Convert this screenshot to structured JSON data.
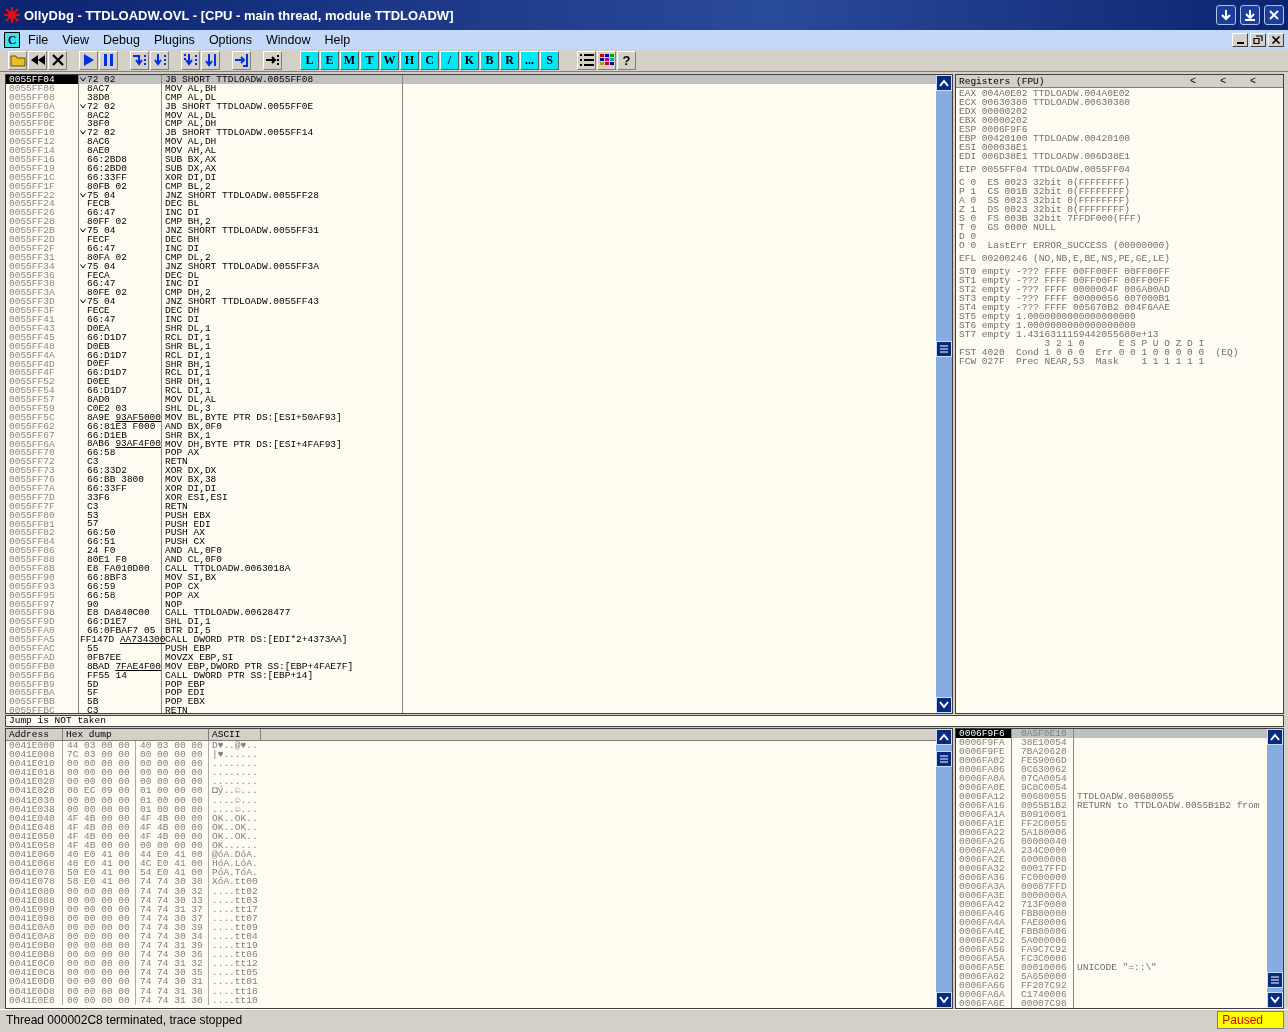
{
  "window": {
    "title": "OllyDbg - TTDLOADW.OVL - [CPU - main thread, module TTDLOADW]"
  },
  "menu": {
    "icon_letter": "C",
    "items": [
      "File",
      "View",
      "Debug",
      "Plugins",
      "Options",
      "Window",
      "Help"
    ]
  },
  "toolbar": {
    "window_buttons": [
      "L",
      "E",
      "M",
      "T",
      "W",
      "H",
      "C",
      "/",
      "K",
      "B",
      "R",
      "...",
      "S"
    ],
    "help": "?"
  },
  "disasm": {
    "rows": [
      {
        "address": "0055FF04",
        "hex": "72 02",
        "command": "JB SHORT TTDLOADW.0055FF08",
        "jump": true,
        "selected": true
      },
      {
        "address": "0055FF06",
        "hex": "8AC7",
        "command": "MOV AL,BH",
        "jump": false,
        "selected": false
      },
      {
        "address": "0055FF08",
        "hex": "38D0",
        "command": "CMP AL,DL",
        "jump": false,
        "selected": false
      },
      {
        "address": "0055FF0A",
        "hex": "72 02",
        "command": "JB SHORT TTDLOADW.0055FF0E",
        "jump": true,
        "selected": false
      },
      {
        "address": "0055FF0C",
        "hex": "8AC2",
        "command": "MOV AL,DL",
        "jump": false,
        "selected": false
      },
      {
        "address": "0055FF0E",
        "hex": "38F0",
        "command": "CMP AL,DH",
        "jump": false,
        "selected": false
      },
      {
        "address": "0055FF10",
        "hex": "72 02",
        "command": "JB SHORT TTDLOADW.0055FF14",
        "jump": true,
        "selected": false
      },
      {
        "address": "0055FF12",
        "hex": "8AC6",
        "command": "MOV AL,DH",
        "jump": false,
        "selected": false
      },
      {
        "address": "0055FF14",
        "hex": "8AE0",
        "command": "MOV AH,AL",
        "jump": false,
        "selected": false
      },
      {
        "address": "0055FF16",
        "hex": "66:2BD8",
        "command": "SUB BX,AX",
        "jump": false,
        "selected": false
      },
      {
        "address": "0055FF19",
        "hex": "66:2BD0",
        "command": "SUB DX,AX",
        "jump": false,
        "selected": false
      },
      {
        "address": "0055FF1C",
        "hex": "66:33FF",
        "command": "XOR DI,DI",
        "jump": false,
        "selected": false
      },
      {
        "address": "0055FF1F",
        "hex": "80FB 02",
        "command": "CMP BL,2",
        "jump": false,
        "selected": false
      },
      {
        "address": "0055FF22",
        "hex": "75 04",
        "command": "JNZ SHORT TTDLOADW.0055FF28",
        "jump": true,
        "selected": false
      },
      {
        "address": "0055FF24",
        "hex": "FECB",
        "command": "DEC BL",
        "jump": false,
        "selected": false
      },
      {
        "address": "0055FF26",
        "hex": "66:47",
        "command": "INC DI",
        "jump": false,
        "selected": false
      },
      {
        "address": "0055FF28",
        "hex": "80FF 02",
        "command": "CMP BH,2",
        "jump": false,
        "selected": false
      },
      {
        "address": "0055FF2B",
        "hex": "75 04",
        "command": "JNZ SHORT TTDLOADW.0055FF31",
        "jump": true,
        "selected": false
      },
      {
        "address": "0055FF2D",
        "hex": "FECF",
        "command": "DEC BH",
        "jump": false,
        "selected": false
      },
      {
        "address": "0055FF2F",
        "hex": "66:47",
        "command": "INC DI",
        "jump": false,
        "selected": false
      },
      {
        "address": "0055FF31",
        "hex": "80FA 02",
        "command": "CMP DL,2",
        "jump": false,
        "selected": false
      },
      {
        "address": "0055FF34",
        "hex": "75 04",
        "command": "JNZ SHORT TTDLOADW.0055FF3A",
        "jump": true,
        "selected": false
      },
      {
        "address": "0055FF36",
        "hex": "FECA",
        "command": "DEC DL",
        "jump": false,
        "selected": false
      },
      {
        "address": "0055FF38",
        "hex": "66:47",
        "command": "INC DI",
        "jump": false,
        "selected": false
      },
      {
        "address": "0055FF3A",
        "hex": "80FE 02",
        "command": "CMP DH,2",
        "jump": false,
        "selected": false
      },
      {
        "address": "0055FF3D",
        "hex": "75 04",
        "command": "JNZ SHORT TTDLOADW.0055FF43",
        "jump": true,
        "selected": false
      },
      {
        "address": "0055FF3F",
        "hex": "FECE",
        "command": "DEC DH",
        "jump": false,
        "selected": false
      },
      {
        "address": "0055FF41",
        "hex": "66:47",
        "command": "INC DI",
        "jump": false,
        "selected": false
      },
      {
        "address": "0055FF43",
        "hex": "D0EA",
        "command": "SHR DL,1",
        "jump": false,
        "selected": false
      },
      {
        "address": "0055FF45",
        "hex": "66:D1D7",
        "command": "RCL DI,1",
        "jump": false,
        "selected": false
      },
      {
        "address": "0055FF48",
        "hex": "D0EB",
        "command": "SHR BL,1",
        "jump": false,
        "selected": false
      },
      {
        "address": "0055FF4A",
        "hex": "66:D1D7",
        "command": "RCL DI,1",
        "jump": false,
        "selected": false
      },
      {
        "address": "0055FF4D",
        "hex": "D0EF",
        "command": "SHR BH,1",
        "jump": false,
        "selected": false
      },
      {
        "address": "0055FF4F",
        "hex": "66:D1D7",
        "command": "RCL DI,1",
        "jump": false,
        "selected": false
      },
      {
        "address": "0055FF52",
        "hex": "D0EE",
        "command": "SHR DH,1",
        "jump": false,
        "selected": false
      },
      {
        "address": "0055FF54",
        "hex": "66:D1D7",
        "command": "RCL DI,1",
        "jump": false,
        "selected": false
      },
      {
        "address": "0055FF57",
        "hex": "8AD0",
        "command": "MOV DL,AL",
        "jump": false,
        "selected": false
      },
      {
        "address": "0055FF59",
        "hex": "C0E2 03",
        "command": "SHL DL,3",
        "jump": false,
        "selected": false
      },
      {
        "address": "0055FF5C",
        "hex": "8A9E",
        "fixup": "93AF5000",
        "command": "MOV BL,BYTE PTR DS:[ESI+50AF93]",
        "jump": false,
        "selected": false
      },
      {
        "address": "0055FF62",
        "hex": "66:81E3 F000",
        "command": "AND BX,0F0",
        "jump": false,
        "selected": false
      },
      {
        "address": "0055FF67",
        "hex": "66:D1EB",
        "command": "SHR BX,1",
        "jump": false,
        "selected": false
      },
      {
        "address": "0055FF6A",
        "hex": "8AB6",
        "fixup": "93AF4F00",
        "command": "MOV DH,BYTE PTR DS:[ESI+4FAF93]",
        "jump": false,
        "selected": false
      },
      {
        "address": "0055FF70",
        "hex": "66:58",
        "command": "POP AX",
        "jump": false,
        "selected": false
      },
      {
        "address": "0055FF72",
        "hex": "C3",
        "command": "RETN",
        "jump": false,
        "selected": false
      },
      {
        "address": "0055FF73",
        "hex": "66:33D2",
        "command": "XOR DX,DX",
        "jump": false,
        "selected": false
      },
      {
        "address": "0055FF76",
        "hex": "66:BB 3800",
        "command": "MOV BX,38",
        "jump": false,
        "selected": false
      },
      {
        "address": "0055FF7A",
        "hex": "66:33FF",
        "command": "XOR DI,DI",
        "jump": false,
        "selected": false
      },
      {
        "address": "0055FF7D",
        "hex": "33F6",
        "command": "XOR ESI,ESI",
        "jump": false,
        "selected": false
      },
      {
        "address": "0055FF7F",
        "hex": "C3",
        "command": "RETN",
        "jump": false,
        "selected": false
      },
      {
        "address": "0055FF80",
        "hex": "53",
        "command": "PUSH EBX",
        "jump": false,
        "selected": false
      },
      {
        "address": "0055FF81",
        "hex": "57",
        "command": "PUSH EDI",
        "jump": false,
        "selected": false
      },
      {
        "address": "0055FF82",
        "hex": "66:50",
        "command": "PUSH AX",
        "jump": false,
        "selected": false
      },
      {
        "address": "0055FF84",
        "hex": "66:51",
        "command": "PUSH CX",
        "jump": false,
        "selected": false
      },
      {
        "address": "0055FF86",
        "hex": "24 F0",
        "command": "AND AL,0F0",
        "jump": false,
        "selected": false
      },
      {
        "address": "0055FF88",
        "hex": "80E1 F0",
        "command": "AND CL,0F0",
        "jump": false,
        "selected": false
      },
      {
        "address": "0055FF8B",
        "hex": "E8 FA010D00",
        "command": "CALL TTDLOADW.0063018A",
        "jump": false,
        "selected": false
      },
      {
        "address": "0055FF90",
        "hex": "66:8BF3",
        "command": "MOV SI,BX",
        "jump": false,
        "selected": false
      },
      {
        "address": "0055FF93",
        "hex": "66:59",
        "command": "POP CX",
        "jump": false,
        "selected": false
      },
      {
        "address": "0055FF95",
        "hex": "66:58",
        "command": "POP AX",
        "jump": false,
        "selected": false
      },
      {
        "address": "0055FF97",
        "hex": "90",
        "command": "NOP",
        "jump": false,
        "selected": false
      },
      {
        "address": "0055FF98",
        "hex": "E8 DA840C00",
        "command": "CALL TTDLOADW.00628477",
        "jump": false,
        "selected": false
      },
      {
        "address": "0055FF9D",
        "hex": "66:D1E7",
        "command": "SHL DI,1",
        "jump": false,
        "selected": false
      },
      {
        "address": "0055FFA0",
        "hex": "66:0FBAF7 05",
        "command": "BTR DI,5",
        "jump": false,
        "selected": false
      },
      {
        "address": "0055FFA5",
        "hex": "FF147D",
        "fixup": "AA734300",
        "command": "CALL DWORD PTR DS:[EDI*2+4373AA]",
        "jump": false,
        "selected": false
      },
      {
        "address": "0055FFAC",
        "hex": "55",
        "command": "PUSH EBP",
        "jump": false,
        "selected": false
      },
      {
        "address": "0055FFAD",
        "hex": "0FB7EE",
        "command": "MOVZX EBP,SI",
        "jump": false,
        "selected": false
      },
      {
        "address": "0055FFB0",
        "hex": "8BAD",
        "fixup": "7FAE4F00",
        "command": "MOV EBP,DWORD PTR SS:[EBP+4FAE7F]",
        "jump": false,
        "selected": false
      },
      {
        "address": "0055FFB6",
        "hex": "FF55 14",
        "command": "CALL DWORD PTR SS:[EBP+14]",
        "jump": false,
        "selected": false
      },
      {
        "address": "0055FFB9",
        "hex": "5D",
        "command": "POP EBP",
        "jump": false,
        "selected": false
      },
      {
        "address": "0055FFBA",
        "hex": "5F",
        "command": "POP EDI",
        "jump": false,
        "selected": false
      },
      {
        "address": "0055FFBB",
        "hex": "5B",
        "command": "POP EBX",
        "jump": false,
        "selected": false
      },
      {
        "address": "0055FFBC",
        "hex": "C3",
        "command": "RETN",
        "jump": false,
        "selected": false
      }
    ]
  },
  "registers": {
    "title": "Registers (FPU)",
    "arrows": [
      "<",
      "<",
      "<"
    ],
    "groups": [
      [
        "EAX 004A0E02 TTDLOADW.004A0E02",
        "ECX 00630380 TTDLOADW.00630380",
        "EDX 00000202",
        "EBX 00000202",
        "ESP 0006F9F6",
        "EBP 00420100 TTDLOADW.00420100",
        "ESI 000038E1",
        "EDI 006D38E1 TTDLOADW.006D38E1"
      ],
      [
        "EIP 0055FF04 TTDLOADW.0055FF04"
      ],
      [
        "C 0  ES 0023 32bit 0(FFFFFFFF)",
        "P 1  CS 001B 32bit 0(FFFFFFFF)",
        "A 0  SS 0023 32bit 0(FFFFFFFF)",
        "Z 1  DS 0023 32bit 0(FFFFFFFF)",
        "S 0  FS 003B 32bit 7FFDF000(FFF)",
        "T 0  GS 0000 NULL",
        "D 0",
        "O 0  LastErr ERROR_SUCCESS (00000000)"
      ],
      [
        "EFL 00200246 (NO,NB,E,BE,NS,PE,GE,LE)"
      ],
      [
        "ST0 empty -??? FFFF 00FF00FF 00FF00FF",
        "ST1 empty -??? FFFF 00FF00FF 00FF00FF",
        "ST2 empty -??? FFFF 0000004F 006A00AD",
        "ST3 empty -??? FFFF 00000056 007000B1",
        "ST4 empty -??? FFFF 005670B2 004F6AAE",
        "ST5 empty 1.0000000000000000000",
        "ST6 empty 1.0000000000000000000",
        "ST7 empty 1.4316311159442055680e+13",
        "               3 2 1 0      E S P U O Z D I",
        "FST 4020  Cond 1 0 0 0  Err 0 0 1 0 0 0 0 0  (EQ)",
        "FCW 027F  Prec NEAR,53  Mask    1 1 1 1 1 1"
      ]
    ]
  },
  "info": "Jump is NOT taken",
  "dump": {
    "columns": [
      "Address",
      "Hex dump",
      "ASCII"
    ],
    "rows": [
      {
        "address": "0041E000",
        "hex": [
          "44 03 00 00",
          "40 03 00 00"
        ],
        "ascii": "D♥..@♥.."
      },
      {
        "address": "0041E008",
        "hex": [
          "7C 03 00 00",
          "00 00 00 00"
        ],
        "ascii": "|♥......"
      },
      {
        "address": "0041E010",
        "hex": [
          "00 00 00 00",
          "00 00 00 00"
        ],
        "ascii": "........"
      },
      {
        "address": "0041E018",
        "hex": [
          "00 00 00 00",
          "00 00 00 00"
        ],
        "ascii": "........"
      },
      {
        "address": "0041E020",
        "hex": [
          "00 00 00 00",
          "00 00 00 00"
        ],
        "ascii": "........"
      },
      {
        "address": "0041E028",
        "hex": [
          "08 EC 09 00",
          "01 00 00 00"
        ],
        "ascii": "◘ý..☺..."
      },
      {
        "address": "0041E030",
        "hex": [
          "00 00 00 00",
          "01 00 00 00"
        ],
        "ascii": "....☺..."
      },
      {
        "address": "0041E038",
        "hex": [
          "00 00 00 00",
          "01 00 00 00"
        ],
        "ascii": "....☺..."
      },
      {
        "address": "0041E040",
        "hex": [
          "4F 4B 00 00",
          "4F 4B 00 00"
        ],
        "ascii": "OK..OK.."
      },
      {
        "address": "0041E048",
        "hex": [
          "4F 4B 00 00",
          "4F 4B 00 00"
        ],
        "ascii": "OK..OK.."
      },
      {
        "address": "0041E050",
        "hex": [
          "4F 4B 00 00",
          "4F 4B 00 00"
        ],
        "ascii": "OK..OK.."
      },
      {
        "address": "0041E058",
        "hex": [
          "4F 4B 00 00",
          "00 00 00 00"
        ],
        "ascii": "OK......"
      },
      {
        "address": "0041E060",
        "hex": [
          "40 E0 41 00",
          "44 E0 41 00"
        ],
        "ascii": "@óA.DóA."
      },
      {
        "address": "0041E068",
        "hex": [
          "48 E0 41 00",
          "4C E0 41 00"
        ],
        "ascii": "HóA.LóA."
      },
      {
        "address": "0041E070",
        "hex": [
          "50 E0 41 00",
          "54 E0 41 00"
        ],
        "ascii": "PóA.TóA."
      },
      {
        "address": "0041E078",
        "hex": [
          "58 E0 41 00",
          "74 74 30 30"
        ],
        "ascii": "XóA.tt00"
      },
      {
        "address": "0041E080",
        "hex": [
          "00 00 00 00",
          "74 74 30 32"
        ],
        "ascii": "....tt02"
      },
      {
        "address": "0041E088",
        "hex": [
          "00 00 00 00",
          "74 74 30 33"
        ],
        "ascii": "....tt03"
      },
      {
        "address": "0041E090",
        "hex": [
          "00 00 00 00",
          "74 74 31 37"
        ],
        "ascii": "....tt17"
      },
      {
        "address": "0041E098",
        "hex": [
          "00 00 00 00",
          "74 74 30 37"
        ],
        "ascii": "....tt07"
      },
      {
        "address": "0041E0A0",
        "hex": [
          "00 00 00 00",
          "74 74 30 39"
        ],
        "ascii": "....tt09"
      },
      {
        "address": "0041E0A8",
        "hex": [
          "00 00 00 00",
          "74 74 30 34"
        ],
        "ascii": "....tt04"
      },
      {
        "address": "0041E0B0",
        "hex": [
          "00 00 00 00",
          "74 74 31 39"
        ],
        "ascii": "....tt19"
      },
      {
        "address": "0041E0B8",
        "hex": [
          "00 00 00 00",
          "74 74 30 36"
        ],
        "ascii": "....tt06"
      },
      {
        "address": "0041E0C0",
        "hex": [
          "00 00 00 00",
          "74 74 31 32"
        ],
        "ascii": "....tt12"
      },
      {
        "address": "0041E0C8",
        "hex": [
          "00 00 00 00",
          "74 74 30 35"
        ],
        "ascii": "....tt05"
      },
      {
        "address": "0041E0D0",
        "hex": [
          "00 00 00 00",
          "74 74 30 31"
        ],
        "ascii": "....tt01"
      },
      {
        "address": "0041E0D8",
        "hex": [
          "00 00 00 00",
          "74 74 31 38"
        ],
        "ascii": "....tt18"
      },
      {
        "address": "0041E0E0",
        "hex": [
          "00 00 00 00",
          "74 74 31 30"
        ],
        "ascii": "....tt10"
      }
    ]
  },
  "stack": {
    "rows": [
      {
        "address": "0006F9F6",
        "value": "0A5F0E10",
        "selected": true
      },
      {
        "address": "0006F9FA",
        "value": "38E10054",
        "selected": false
      },
      {
        "address": "0006F9FE",
        "value": "7BA20620",
        "selected": false
      },
      {
        "address": "0006FA02",
        "value": "FE59006D",
        "selected": false
      },
      {
        "address": "0006FA06",
        "value": "0C630062",
        "selected": false
      },
      {
        "address": "0006FA0A",
        "value": "07CA0054",
        "selected": false
      },
      {
        "address": "0006FA0E",
        "value": "9C8C0054",
        "selected": false
      },
      {
        "address": "0006FA12",
        "value": "00680055",
        "comment": "TTDLOADW.00680055",
        "selected": false
      },
      {
        "address": "0006FA16",
        "value": "0055B1B2",
        "comment": "RETURN to TTDLOADW.0055B1B2 from",
        "selected": false
      },
      {
        "address": "0006FA1A",
        "value": "B0910001",
        "selected": false
      },
      {
        "address": "0006FA1E",
        "value": "FF2C0055",
        "selected": false
      },
      {
        "address": "0006FA22",
        "value": "5A180006",
        "selected": false
      },
      {
        "address": "0006FA26",
        "value": "00000040",
        "selected": false
      },
      {
        "address": "0006FA2A",
        "value": "234C0000",
        "selected": false
      },
      {
        "address": "0006FA2E",
        "value": "60000008",
        "selected": false
      },
      {
        "address": "0006FA32",
        "value": "00017FFD",
        "selected": false
      },
      {
        "address": "0006FA36",
        "value": "FC000000",
        "selected": false
      },
      {
        "address": "0006FA3A",
        "value": "00087FFD",
        "selected": false
      },
      {
        "address": "0006FA3E",
        "value": "0000000A",
        "selected": false
      },
      {
        "address": "0006FA42",
        "value": "713F0000",
        "selected": false
      },
      {
        "address": "0006FA46",
        "value": "FBB00000",
        "selected": false
      },
      {
        "address": "0006FA4A",
        "value": "FAE80006",
        "selected": false
      },
      {
        "address": "0006FA4E",
        "value": "FBB00006",
        "selected": false
      },
      {
        "address": "0006FA52",
        "value": "5A000006",
        "selected": false
      },
      {
        "address": "0006FA56",
        "value": "FA9C7C92",
        "selected": false
      },
      {
        "address": "0006FA5A",
        "value": "FC3C0006",
        "selected": false
      },
      {
        "address": "0006FA5E",
        "value": "00010006",
        "comment": "UNICODE \"=::\\\"",
        "selected": false
      },
      {
        "address": "0006FA62",
        "value": "5A650000",
        "selected": false
      },
      {
        "address": "0006FA66",
        "value": "FF207C92",
        "selected": false
      },
      {
        "address": "0006FA6A",
        "value": "C1740006",
        "selected": false
      },
      {
        "address": "0006FA6E",
        "value": "00007C98",
        "selected": false
      }
    ]
  },
  "status_bar": {
    "message": "Thread 000002C8 terminated, trace stopped",
    "state": "Paused"
  }
}
